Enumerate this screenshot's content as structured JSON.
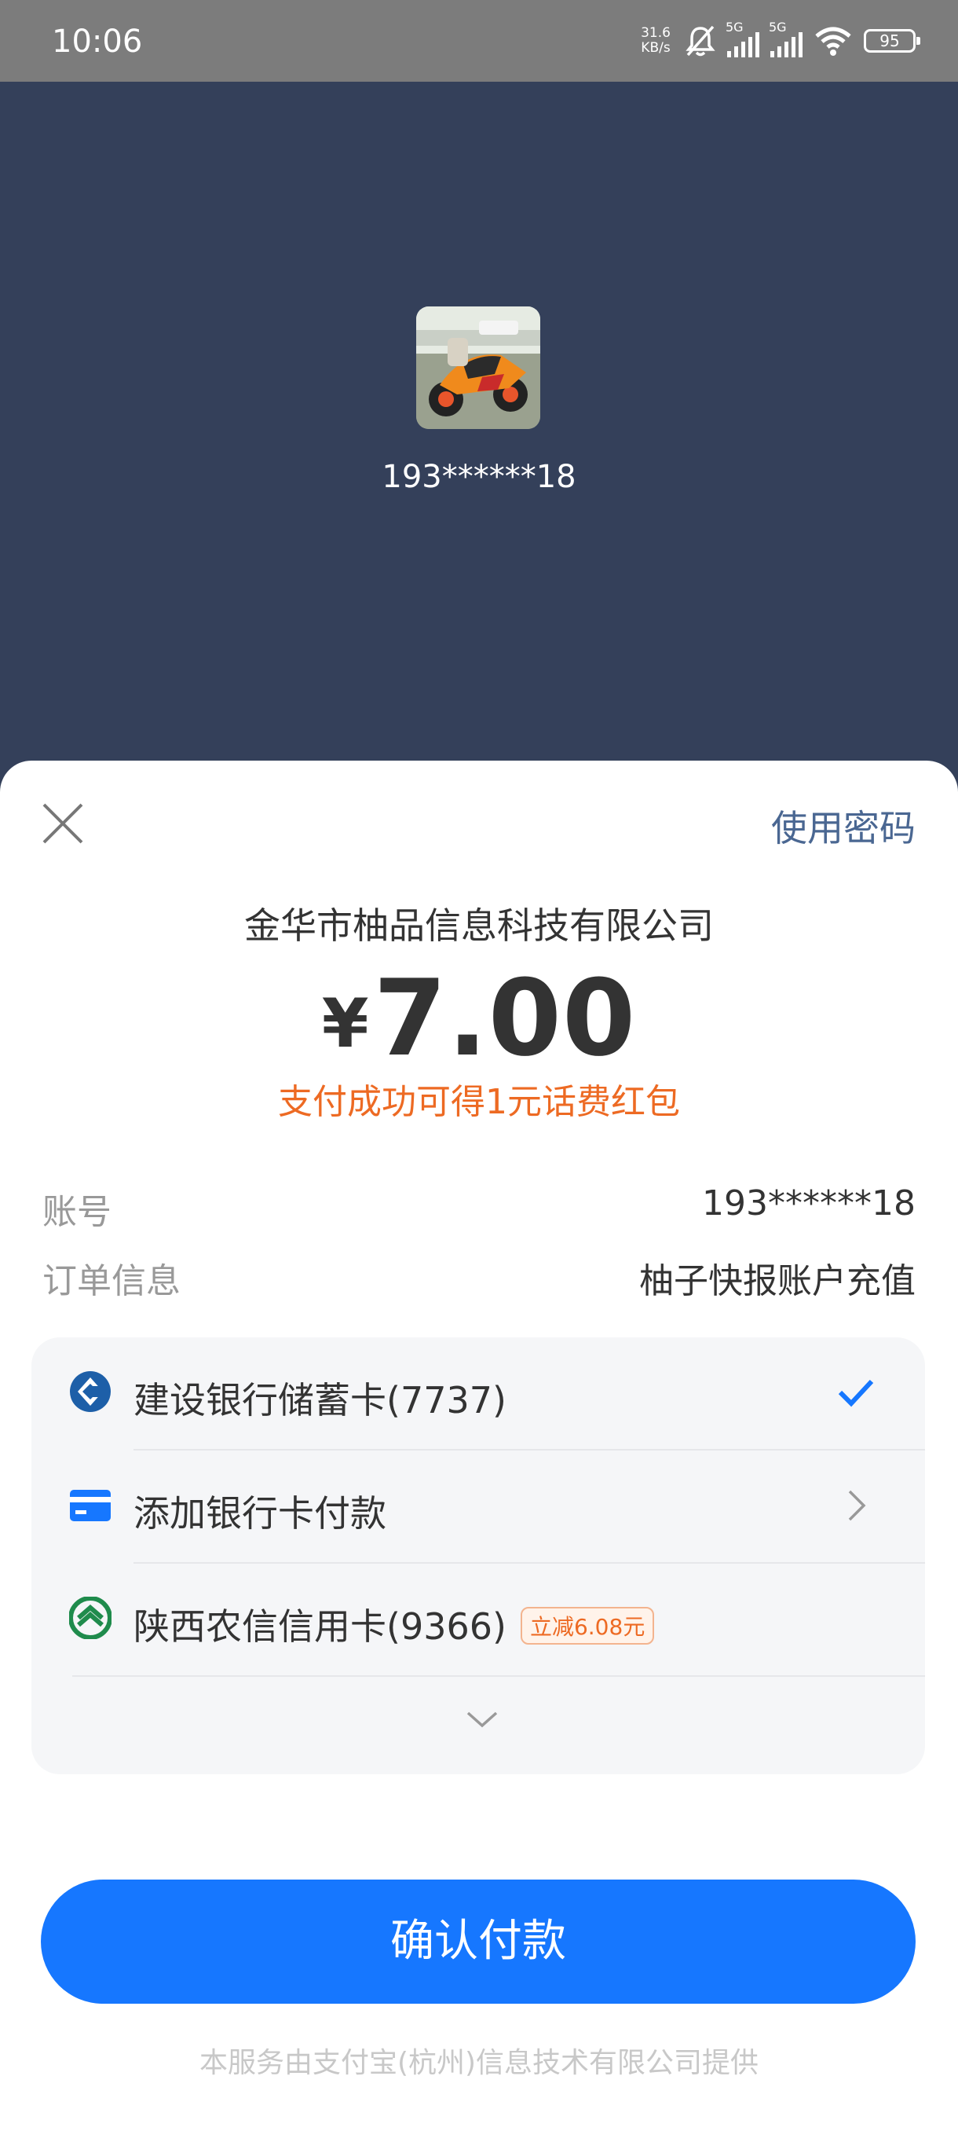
{
  "status_bar": {
    "time": "10:06",
    "net_speed_value": "31.6",
    "net_speed_unit": "KB/s",
    "sim1_label": "5G",
    "sim2_label": "5G",
    "battery_level": "95"
  },
  "payee": {
    "account_masked": "193******18"
  },
  "sheet": {
    "use_password_label": "使用密码",
    "merchant_name": "金华市柚品信息科技有限公司",
    "currency_symbol": "¥",
    "amount": "7.00",
    "promo_text": "支付成功可得1元话费红包",
    "details": [
      {
        "label": "账号",
        "value": "193******18"
      },
      {
        "label": "订单信息",
        "value": "柚子快报账户充值"
      }
    ],
    "payment_methods": [
      {
        "label": "建设银行储蓄卡(7737)",
        "icon": "ccb-bank-icon",
        "state": "selected"
      },
      {
        "label": "添加银行卡付款",
        "icon": "bank-card-icon",
        "state": "navigate"
      },
      {
        "label": "陕西农信信用卡(9366)",
        "icon": "shaanxi-rcc-icon",
        "badge": "立减6.08元"
      }
    ],
    "confirm_label": "确认付款",
    "footer_text": "本服务由支付宝(杭州)信息技术有限公司提供"
  },
  "colors": {
    "header_bg": "#34405a",
    "accent_blue": "#1677ff",
    "promo_orange": "#ed6a23",
    "link_blue": "#4a6792"
  }
}
